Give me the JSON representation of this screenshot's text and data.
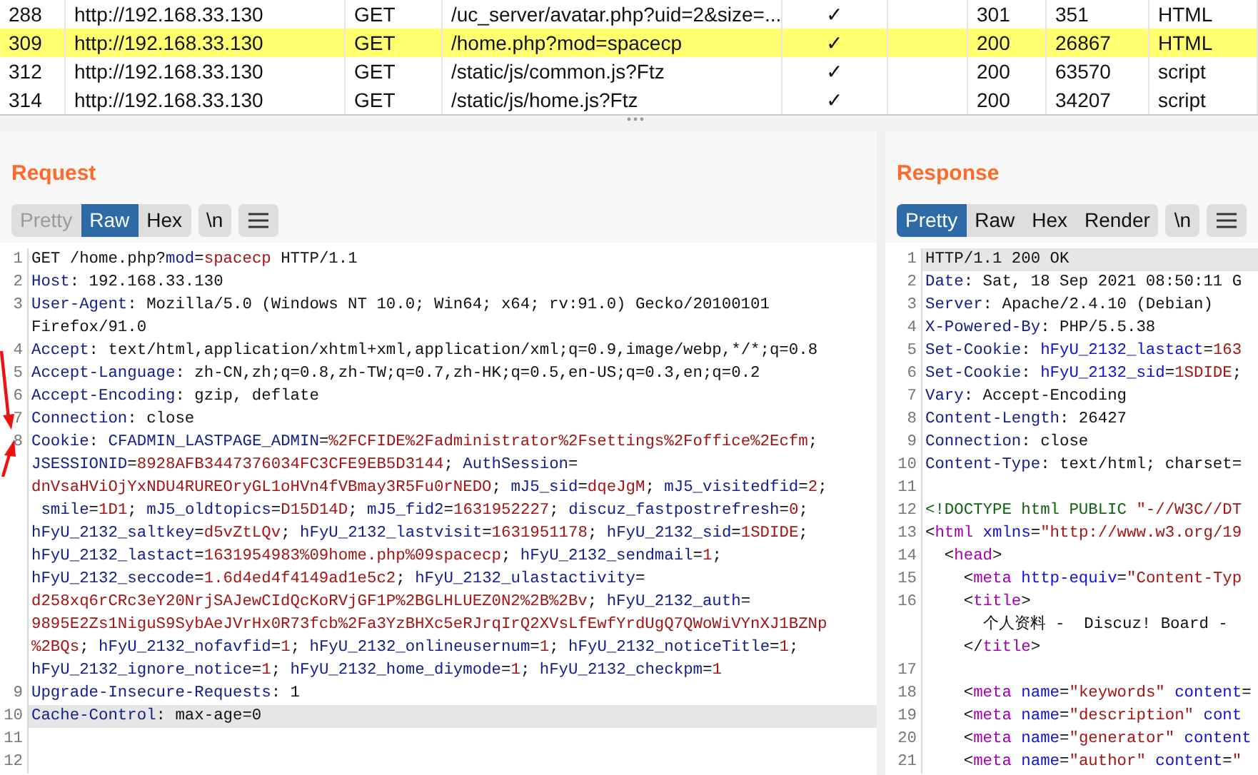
{
  "history": {
    "rows": [
      {
        "selected": false,
        "cells": [
          "288",
          "http://192.168.33.130",
          "GET",
          "/uc_server/avatar.php?uid=2&size=...",
          "✓",
          "301",
          "351",
          "HTML"
        ]
      },
      {
        "selected": true,
        "cells": [
          "309",
          "http://192.168.33.130",
          "GET",
          "/home.php?mod=spacecp",
          "✓",
          "200",
          "26867",
          "HTML"
        ]
      },
      {
        "selected": false,
        "cells": [
          "312",
          "http://192.168.33.130",
          "GET",
          "/static/js/common.js?Ftz",
          "✓",
          "200",
          "63570",
          "script"
        ]
      },
      {
        "selected": false,
        "cells": [
          "314",
          "http://192.168.33.130",
          "GET",
          "/static/js/home.js?Ftz",
          "✓",
          "200",
          "34207",
          "script"
        ]
      }
    ]
  },
  "request": {
    "title": "Request",
    "tabs": [
      {
        "label": "Pretty",
        "selected": false,
        "disabled": true
      },
      {
        "label": "Raw",
        "selected": true,
        "disabled": false
      },
      {
        "label": "Hex",
        "selected": false,
        "disabled": false
      }
    ],
    "newline_button": "\\n",
    "lines": [
      {
        "number": "1",
        "selected": false,
        "rows": [
          {
            "segments": [
              {
                "kind": "plain",
                "text": "GET /home.php?"
              },
              {
                "kind": "name",
                "text": "mod"
              },
              {
                "kind": "plain",
                "text": "="
              },
              {
                "kind": "value",
                "text": "spacecp"
              },
              {
                "kind": "plain",
                "text": " HTTP/1.1"
              }
            ]
          }
        ]
      },
      {
        "number": "2",
        "selected": false,
        "rows": [
          {
            "segments": [
              {
                "kind": "name",
                "text": "Host"
              },
              {
                "kind": "plain",
                "text": ": 192.168.33.130"
              }
            ]
          }
        ]
      },
      {
        "number": "3",
        "selected": false,
        "rows": [
          {
            "segments": [
              {
                "kind": "name",
                "text": "User-Agent"
              },
              {
                "kind": "plain",
                "text": ": Mozilla/5.0 (Windows NT 10.0; Win64; x64; rv:91.0) Gecko/20100101"
              }
            ]
          },
          {
            "segments": [
              {
                "kind": "plain",
                "text": "Firefox/91.0"
              }
            ]
          }
        ]
      },
      {
        "number": "4",
        "selected": false,
        "rows": [
          {
            "segments": [
              {
                "kind": "name",
                "text": "Accept"
              },
              {
                "kind": "plain",
                "text": ": text/html,application/xhtml+xml,application/xml;q=0.9,image/webp,*/*;q=0.8"
              }
            ]
          }
        ]
      },
      {
        "number": "5",
        "selected": false,
        "rows": [
          {
            "segments": [
              {
                "kind": "name",
                "text": "Accept-Language"
              },
              {
                "kind": "plain",
                "text": ": zh-CN,zh;q=0.8,zh-TW;q=0.7,zh-HK;q=0.5,en-US;q=0.3,en;q=0.2"
              }
            ]
          }
        ]
      },
      {
        "number": "6",
        "selected": false,
        "rows": [
          {
            "segments": [
              {
                "kind": "name",
                "text": "Accept-Encoding"
              },
              {
                "kind": "plain",
                "text": ": gzip, deflate"
              }
            ]
          }
        ]
      },
      {
        "number": "7",
        "selected": false,
        "rows": [
          {
            "segments": [
              {
                "kind": "name",
                "text": "Connection"
              },
              {
                "kind": "plain",
                "text": ": close"
              }
            ]
          }
        ]
      },
      {
        "number": "8",
        "selected": false,
        "rows": [
          {
            "segments": [
              {
                "kind": "name",
                "text": "Cookie"
              },
              {
                "kind": "plain",
                "text": ": "
              },
              {
                "kind": "name",
                "text": "CFADMIN_LASTPAGE_ADMIN"
              },
              {
                "kind": "plain",
                "text": "="
              },
              {
                "kind": "value",
                "text": "%2FCFIDE%2Fadministrator%2Fsettings%2Foffice%2Ecfm"
              },
              {
                "kind": "plain",
                "text": ";"
              }
            ]
          },
          {
            "segments": [
              {
                "kind": "name",
                "text": "JSESSIONID"
              },
              {
                "kind": "plain",
                "text": "="
              },
              {
                "kind": "value",
                "text": "8928AFB3447376034FC3CFE9EB5D3144"
              },
              {
                "kind": "plain",
                "text": "; "
              },
              {
                "kind": "name",
                "text": "AuthSession"
              },
              {
                "kind": "plain",
                "text": "="
              }
            ]
          },
          {
            "segments": [
              {
                "kind": "value",
                "text": "dnVsaHViOjYxNDU4RUREOryGL1oHVn4fVBmay3R5Fu0rNEDO"
              },
              {
                "kind": "plain",
                "text": "; "
              },
              {
                "kind": "name",
                "text": "mJ5_sid"
              },
              {
                "kind": "plain",
                "text": "="
              },
              {
                "kind": "value",
                "text": "dqeJgM"
              },
              {
                "kind": "plain",
                "text": "; "
              },
              {
                "kind": "name",
                "text": "mJ5_visitedfid"
              },
              {
                "kind": "plain",
                "text": "="
              },
              {
                "kind": "value",
                "text": "2"
              },
              {
                "kind": "plain",
                "text": ";"
              }
            ]
          },
          {
            "segments": [
              {
                "kind": "name",
                "text": " smile"
              },
              {
                "kind": "plain",
                "text": "="
              },
              {
                "kind": "value",
                "text": "1D1"
              },
              {
                "kind": "plain",
                "text": "; "
              },
              {
                "kind": "name",
                "text": "mJ5_oldtopics"
              },
              {
                "kind": "plain",
                "text": "="
              },
              {
                "kind": "value",
                "text": "D15D14D"
              },
              {
                "kind": "plain",
                "text": "; "
              },
              {
                "kind": "name",
                "text": "mJ5_fid2"
              },
              {
                "kind": "plain",
                "text": "="
              },
              {
                "kind": "value",
                "text": "1631952227"
              },
              {
                "kind": "plain",
                "text": "; "
              },
              {
                "kind": "name",
                "text": "discuz_fastpostrefresh"
              },
              {
                "kind": "plain",
                "text": "="
              },
              {
                "kind": "value",
                "text": "0"
              },
              {
                "kind": "plain",
                "text": ";"
              }
            ]
          },
          {
            "segments": [
              {
                "kind": "name",
                "text": "hFyU_2132_saltkey"
              },
              {
                "kind": "plain",
                "text": "="
              },
              {
                "kind": "value",
                "text": "d5vZtLQv"
              },
              {
                "kind": "plain",
                "text": "; "
              },
              {
                "kind": "name",
                "text": "hFyU_2132_lastvisit"
              },
              {
                "kind": "plain",
                "text": "="
              },
              {
                "kind": "value",
                "text": "1631951178"
              },
              {
                "kind": "plain",
                "text": "; "
              },
              {
                "kind": "name",
                "text": "hFyU_2132_sid"
              },
              {
                "kind": "plain",
                "text": "="
              },
              {
                "kind": "value",
                "text": "1SDIDE"
              },
              {
                "kind": "plain",
                "text": ";"
              }
            ]
          },
          {
            "segments": [
              {
                "kind": "name",
                "text": "hFyU_2132_lastact"
              },
              {
                "kind": "plain",
                "text": "="
              },
              {
                "kind": "value",
                "text": "1631954983%09home.php%09spacecp"
              },
              {
                "kind": "plain",
                "text": "; "
              },
              {
                "kind": "name",
                "text": "hFyU_2132_sendmail"
              },
              {
                "kind": "plain",
                "text": "="
              },
              {
                "kind": "value",
                "text": "1"
              },
              {
                "kind": "plain",
                "text": ";"
              }
            ]
          },
          {
            "segments": [
              {
                "kind": "name",
                "text": "hFyU_2132_seccode"
              },
              {
                "kind": "plain",
                "text": "="
              },
              {
                "kind": "value",
                "text": "1.6d4ed4f4149ad1e5c2"
              },
              {
                "kind": "plain",
                "text": "; "
              },
              {
                "kind": "name",
                "text": "hFyU_2132_ulastactivity"
              },
              {
                "kind": "plain",
                "text": "="
              }
            ]
          },
          {
            "segments": [
              {
                "kind": "value",
                "text": "d258xq6rCRc3eY20NrjSAJewCIdQcKoRVjGF1P%2BGLHLUEZ0N2%2B%2Bv"
              },
              {
                "kind": "plain",
                "text": "; "
              },
              {
                "kind": "name",
                "text": "hFyU_2132_auth"
              },
              {
                "kind": "plain",
                "text": "="
              }
            ]
          },
          {
            "segments": [
              {
                "kind": "value",
                "text": "9895E2Zs1NiguS9SybAeJVrHx0R73fcb%2Fa3YzBHXc5eRJrqIrQ2XVsLfEwfYrdUgQ7QWoWiVYnXJ1BZNp"
              }
            ]
          },
          {
            "segments": [
              {
                "kind": "value",
                "text": "%2BQs"
              },
              {
                "kind": "plain",
                "text": "; "
              },
              {
                "kind": "name",
                "text": "hFyU_2132_nofavfid"
              },
              {
                "kind": "plain",
                "text": "="
              },
              {
                "kind": "value",
                "text": "1"
              },
              {
                "kind": "plain",
                "text": "; "
              },
              {
                "kind": "name",
                "text": "hFyU_2132_onlineusernum"
              },
              {
                "kind": "plain",
                "text": "="
              },
              {
                "kind": "value",
                "text": "1"
              },
              {
                "kind": "plain",
                "text": "; "
              },
              {
                "kind": "name",
                "text": "hFyU_2132_noticeTitle"
              },
              {
                "kind": "plain",
                "text": "="
              },
              {
                "kind": "value",
                "text": "1"
              },
              {
                "kind": "plain",
                "text": ";"
              }
            ]
          },
          {
            "segments": [
              {
                "kind": "name",
                "text": "hFyU_2132_ignore_notice"
              },
              {
                "kind": "plain",
                "text": "="
              },
              {
                "kind": "value",
                "text": "1"
              },
              {
                "kind": "plain",
                "text": "; "
              },
              {
                "kind": "name",
                "text": "hFyU_2132_home_diymode"
              },
              {
                "kind": "plain",
                "text": "="
              },
              {
                "kind": "value",
                "text": "1"
              },
              {
                "kind": "plain",
                "text": "; "
              },
              {
                "kind": "name",
                "text": "hFyU_2132_checkpm"
              },
              {
                "kind": "plain",
                "text": "="
              },
              {
                "kind": "value",
                "text": "1"
              }
            ]
          }
        ]
      },
      {
        "number": "9",
        "selected": false,
        "rows": [
          {
            "segments": [
              {
                "kind": "name",
                "text": "Upgrade-Insecure-Requests"
              },
              {
                "kind": "plain",
                "text": ": 1"
              }
            ]
          }
        ]
      },
      {
        "number": "10",
        "selected": true,
        "rows": [
          {
            "segments": [
              {
                "kind": "name",
                "text": "Cache-Control"
              },
              {
                "kind": "plain",
                "text": ": max-age=0"
              }
            ]
          }
        ]
      },
      {
        "number": "11",
        "selected": false
      },
      {
        "number": "12",
        "selected": false
      }
    ]
  },
  "response": {
    "title": "Response",
    "tabs": [
      {
        "label": "Pretty",
        "selected": true,
        "disabled": false
      },
      {
        "label": "Raw",
        "selected": false,
        "disabled": false
      },
      {
        "label": "Hex",
        "selected": false,
        "disabled": false
      },
      {
        "label": "Render",
        "selected": false,
        "disabled": false
      }
    ],
    "newline_button": "\\n",
    "lines": [
      {
        "number": "1",
        "selected": true,
        "rows": [
          {
            "segments": [
              {
                "kind": "plain",
                "text": "HTTP/1.1 200 OK"
              }
            ]
          }
        ]
      },
      {
        "number": "2",
        "selected": false,
        "rows": [
          {
            "segments": [
              {
                "kind": "name",
                "text": "Date"
              },
              {
                "kind": "plain",
                "text": ": Sat, 18 Sep 2021 08:50:11 G"
              }
            ]
          }
        ]
      },
      {
        "number": "3",
        "selected": false,
        "rows": [
          {
            "segments": [
              {
                "kind": "name",
                "text": "Server"
              },
              {
                "kind": "plain",
                "text": ": Apache/2.4.10 (Debian)"
              }
            ]
          }
        ]
      },
      {
        "number": "4",
        "selected": false,
        "rows": [
          {
            "segments": [
              {
                "kind": "name",
                "text": "X-Powered-By"
              },
              {
                "kind": "plain",
                "text": ": PHP/5.5.38"
              }
            ]
          }
        ]
      },
      {
        "number": "5",
        "selected": false,
        "rows": [
          {
            "segments": [
              {
                "kind": "name",
                "text": "Set-Cookie"
              },
              {
                "kind": "plain",
                "text": ": "
              },
              {
                "kind": "attr",
                "text": "hFyU_2132_lastact"
              },
              {
                "kind": "plain",
                "text": "="
              },
              {
                "kind": "value",
                "text": "163"
              }
            ]
          }
        ]
      },
      {
        "number": "6",
        "selected": false,
        "rows": [
          {
            "segments": [
              {
                "kind": "name",
                "text": "Set-Cookie"
              },
              {
                "kind": "plain",
                "text": ": "
              },
              {
                "kind": "attr",
                "text": "hFyU_2132_sid"
              },
              {
                "kind": "plain",
                "text": "="
              },
              {
                "kind": "value",
                "text": "1SDIDE"
              },
              {
                "kind": "plain",
                "text": ";"
              }
            ]
          }
        ]
      },
      {
        "number": "7",
        "selected": false,
        "rows": [
          {
            "segments": [
              {
                "kind": "name",
                "text": "Vary"
              },
              {
                "kind": "plain",
                "text": ": Accept-Encoding"
              }
            ]
          }
        ]
      },
      {
        "number": "8",
        "selected": false,
        "rows": [
          {
            "segments": [
              {
                "kind": "name",
                "text": "Content-Length"
              },
              {
                "kind": "plain",
                "text": ": 26427"
              }
            ]
          }
        ]
      },
      {
        "number": "9",
        "selected": false,
        "rows": [
          {
            "segments": [
              {
                "kind": "name",
                "text": "Connection"
              },
              {
                "kind": "plain",
                "text": ": close"
              }
            ]
          }
        ]
      },
      {
        "number": "10",
        "selected": false,
        "rows": [
          {
            "segments": [
              {
                "kind": "name",
                "text": "Content-Type"
              },
              {
                "kind": "plain",
                "text": ": text/html; charset="
              }
            ]
          }
        ]
      },
      {
        "number": "11",
        "selected": false
      },
      {
        "number": "12",
        "selected": false,
        "rows": [
          {
            "segments": [
              {
                "kind": "doctype",
                "text": "<!DOCTYPE html PUBLIC "
              },
              {
                "kind": "value",
                "text": "\"-//W3C//DT"
              }
            ]
          }
        ]
      },
      {
        "number": "13",
        "selected": false,
        "rows": [
          {
            "segments": [
              {
                "kind": "plain",
                "text": "<"
              },
              {
                "kind": "tag",
                "text": "html"
              },
              {
                "kind": "attr",
                "text": " xmlns"
              },
              {
                "kind": "plain",
                "text": "="
              },
              {
                "kind": "value",
                "text": "\"http://www.w3.org/19"
              }
            ]
          }
        ]
      },
      {
        "number": "14",
        "selected": false,
        "rows": [
          {
            "segments": [
              {
                "kind": "plain",
                "text": "  <"
              },
              {
                "kind": "tag",
                "text": "head"
              },
              {
                "kind": "plain",
                "text": ">"
              }
            ]
          }
        ]
      },
      {
        "number": "15",
        "selected": false,
        "rows": [
          {
            "segments": [
              {
                "kind": "plain",
                "text": "    <"
              },
              {
                "kind": "tag",
                "text": "meta"
              },
              {
                "kind": "attr",
                "text": " http-equiv"
              },
              {
                "kind": "plain",
                "text": "="
              },
              {
                "kind": "value",
                "text": "\"Content-Typ"
              }
            ]
          }
        ]
      },
      {
        "number": "16",
        "selected": false,
        "rows": [
          {
            "segments": [
              {
                "kind": "plain",
                "text": "    <"
              },
              {
                "kind": "tag",
                "text": "title"
              },
              {
                "kind": "plain",
                "text": ">"
              }
            ]
          },
          {
            "segments": [
              {
                "kind": "plain",
                "text": "      个人资料 -  Discuz! Board -"
              }
            ]
          },
          {
            "segments": [
              {
                "kind": "plain",
                "text": "    </"
              },
              {
                "kind": "tag",
                "text": "title"
              },
              {
                "kind": "plain",
                "text": ">"
              }
            ]
          }
        ]
      },
      {
        "number": "17",
        "selected": false
      },
      {
        "number": "18",
        "selected": false,
        "rows": [
          {
            "segments": [
              {
                "kind": "plain",
                "text": "    <"
              },
              {
                "kind": "tag",
                "text": "meta"
              },
              {
                "kind": "attr",
                "text": " name"
              },
              {
                "kind": "plain",
                "text": "="
              },
              {
                "kind": "value",
                "text": "\"keywords\""
              },
              {
                "kind": "attr",
                "text": " content"
              },
              {
                "kind": "plain",
                "text": "="
              }
            ]
          }
        ]
      },
      {
        "number": "19",
        "selected": false,
        "rows": [
          {
            "segments": [
              {
                "kind": "plain",
                "text": "    <"
              },
              {
                "kind": "tag",
                "text": "meta"
              },
              {
                "kind": "attr",
                "text": " name"
              },
              {
                "kind": "plain",
                "text": "="
              },
              {
                "kind": "value",
                "text": "\"description\""
              },
              {
                "kind": "attr",
                "text": " cont"
              }
            ]
          }
        ]
      },
      {
        "number": "20",
        "selected": false,
        "rows": [
          {
            "segments": [
              {
                "kind": "plain",
                "text": "    <"
              },
              {
                "kind": "tag",
                "text": "meta"
              },
              {
                "kind": "attr",
                "text": " name"
              },
              {
                "kind": "plain",
                "text": "="
              },
              {
                "kind": "value",
                "text": "\"generator\""
              },
              {
                "kind": "attr",
                "text": " content"
              }
            ]
          }
        ]
      },
      {
        "number": "21",
        "selected": false,
        "rows": [
          {
            "segments": [
              {
                "kind": "plain",
                "text": "    <"
              },
              {
                "kind": "tag",
                "text": "meta"
              },
              {
                "kind": "attr",
                "text": " name"
              },
              {
                "kind": "plain",
                "text": "="
              },
              {
                "kind": "value",
                "text": "\"author\""
              },
              {
                "kind": "attr",
                "text": " content"
              },
              {
                "kind": "plain",
                "text": "="
              },
              {
                "kind": "value",
                "text": "\""
              }
            ]
          }
        ]
      }
    ]
  }
}
